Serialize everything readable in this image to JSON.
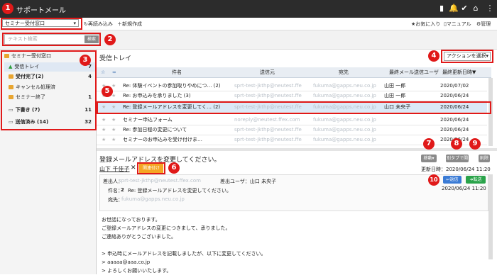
{
  "app": {
    "title": "サポートメール"
  },
  "toolbar": {
    "queue_select": "セミナー受付窓口",
    "reload": "再読み込み",
    "new_compose": "新規作成",
    "favorites": "お気に入り",
    "manual": "マニュアル",
    "admin": "管理"
  },
  "search": {
    "placeholder": "テキスト検索",
    "button": "検索"
  },
  "sidebar": {
    "root": "セミナー受付窓口",
    "items": [
      {
        "label": "受信トレイ",
        "count": "7"
      },
      {
        "label": "受付完了(2)",
        "count": "4"
      },
      {
        "label": "キャンセル処理済",
        "count": ""
      },
      {
        "label": "セミナー終了",
        "count": "1"
      },
      {
        "label": "下書き (7)",
        "count": "11"
      },
      {
        "label": "送信済み (14)",
        "count": "32"
      }
    ]
  },
  "list": {
    "title": "受信トレイ",
    "action_select": "アクションを選択",
    "columns": {
      "subject": "件名",
      "from": "送信元",
      "to": "宛先",
      "last_user": "最終メール送信ユーザ",
      "last_updated": "最終更新日時▼"
    },
    "rows": [
      {
        "subject": "Re: 体験イベントの参加取りやめにつ… (2)",
        "from": "sprt-test-jkthp@neutest.ffe",
        "to": "fukuma@gapps.neu.co.jp",
        "user": "山田 一郎",
        "date": "2020/07/02"
      },
      {
        "subject": "Re: お申込みを承りました (3)",
        "from": "sprt-test-jkthp@neutest.ffe",
        "to": "fukuma@gapps.neu.co.jp",
        "user": "山田 一郎",
        "date": "2020/06/24"
      },
      {
        "subject": "Re: 登録メールアドレスを変更してく… (2)",
        "from": "sprt-test-jkthp@neutest.ffe",
        "to": "fukuma@gapps.neu.co.jp",
        "user": "山口 未央子",
        "date": "2020/06/24"
      },
      {
        "subject": "セミナー申込フォーム",
        "from": "noreply@neutest.ffex.com",
        "to": "fukuma@gapps.neu.co.jp",
        "user": "",
        "date": "2020/06/24"
      },
      {
        "subject": "Re: 参加日程の変更について",
        "from": "sprt-test-jkthp@neutest.ffe",
        "to": "fukuma@gapps.neu.co.jp",
        "user": "",
        "date": "2020/06/24"
      },
      {
        "subject": "セミナーのお申込みを受け付けま…",
        "from": "sprt-test-jkthp@neutest.ffe",
        "to": "fukuma@gapps.neu.co.jp",
        "user": "",
        "date": "2020/06/24"
      }
    ]
  },
  "detail": {
    "subject": "登録メールアドレスを変更してください。",
    "assignee": "山下 千佳子",
    "tag": "関連付け",
    "status_button": "移動",
    "new_tab_button": "別タブで開く",
    "delete_button": "削除",
    "updated_label": "更新日時：2020/06/24 11:20",
    "from_label": "差出人：",
    "from_value": "sprt-test-jkthp@neutest.ffex.com",
    "sender_user": "差出ユーザ：山口 未央子",
    "subject_label": "件名：",
    "subject_num": "2",
    "subject_value": "Re: 登録メールアドレスを変更してください。",
    "to_label": "宛先：",
    "to_value": "fukuma@gapps.neu.co.jp",
    "reply_button": "返信",
    "forward_button": "転送",
    "sent_time": "2020/06/24 11:20",
    "body": [
      "お世話になっております。",
      "ご登録メールアドレスの変更につきまして、承りました。",
      "ご連絡ありがとうございました。",
      "",
      "> 申込時にメールアドレスを記載しましたが、以下に変更してください。",
      "> aaaaa@aaa.co.jp",
      "> よろしくお願いいたします。"
    ]
  },
  "callouts": [
    "1",
    "2",
    "3",
    "4",
    "5",
    "6",
    "7",
    "8",
    "9",
    "10"
  ],
  "colors": {
    "callout_red": "#e01919",
    "topbar": "#2c2c2c",
    "tag_orange": "#f5a623",
    "reply_blue": "#3a7bd5",
    "forward_green": "#2aa34a"
  }
}
